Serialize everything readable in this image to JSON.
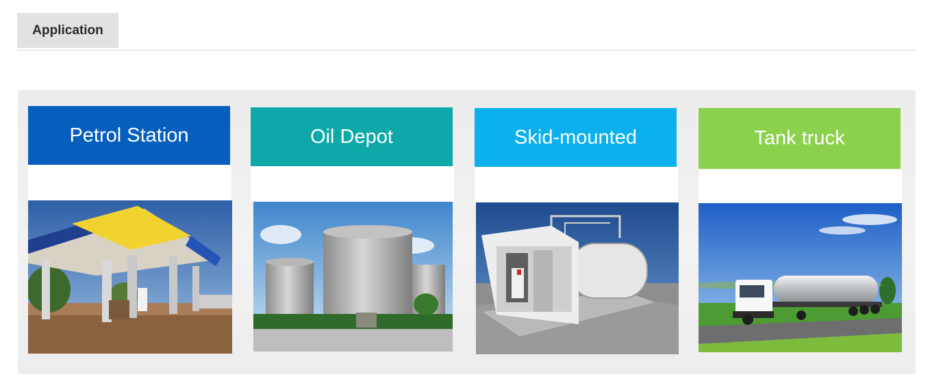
{
  "section_tab": {
    "label": "Application"
  },
  "applications": [
    {
      "title": "Petrol Station",
      "color": "#075fbd",
      "photo": "petrol-station-photo"
    },
    {
      "title": "Oil Depot",
      "color": "#0ea8a8",
      "photo": "oil-depot-photo"
    },
    {
      "title": "Skid-mounted",
      "color": "#0cb0ec",
      "photo": "skid-mounted-station-photo"
    },
    {
      "title": "Tank truck",
      "color": "#8bd14d",
      "photo": "tank-truck-photo"
    }
  ]
}
